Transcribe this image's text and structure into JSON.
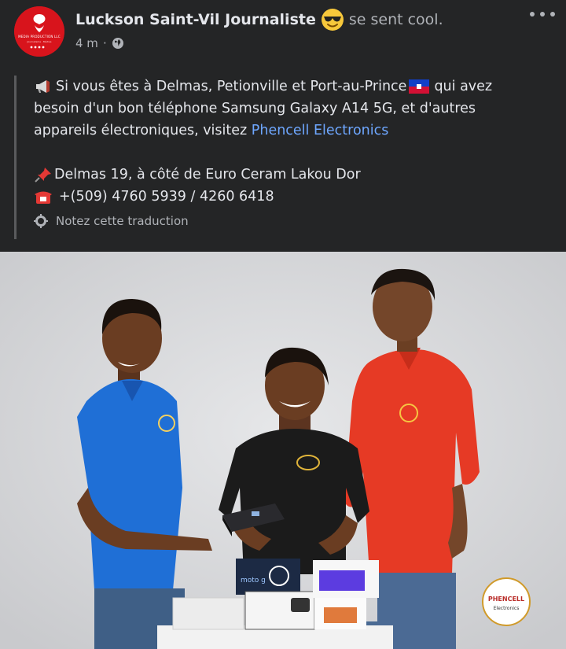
{
  "post": {
    "author": "Luckson Saint-Vil Journaliste",
    "feeling": "se sent cool.",
    "feeling_emoji": "sunglasses-face",
    "time": "4 m",
    "separator": "·",
    "audience_icon": "globe-icon",
    "avatar": {
      "brand": "MEDIA PRODUCTION LLC",
      "sub": "Journalisme · Médias"
    },
    "lines": {
      "l1_text": "Si vous êtes à Delmas, Petionville et Port-au-Prince",
      "l1_after": "qui avez",
      "l2": "besoin d'un bon téléphone Samsung Galaxy A14 5G, et d'autres",
      "l3_before": "appareils électroniques, visitez",
      "l3_link": "Phencell Electronics",
      "l4": "Delmas 19, à côté de Euro Ceram Lakou Dor",
      "l5": "+(509) 4760 5939 / 4260 6418"
    },
    "translate_label": "Notez cette traduction"
  },
  "photo": {
    "box_label": "moto g",
    "logo_text": "PHENCELL",
    "logo_sub": "Electronics"
  },
  "colors": {
    "background": "#242526",
    "link": "#6ea7ff",
    "shirt_blue": "#1f6fd6",
    "shirt_red": "#e63a25",
    "shirt_black": "#1b1b1b"
  }
}
